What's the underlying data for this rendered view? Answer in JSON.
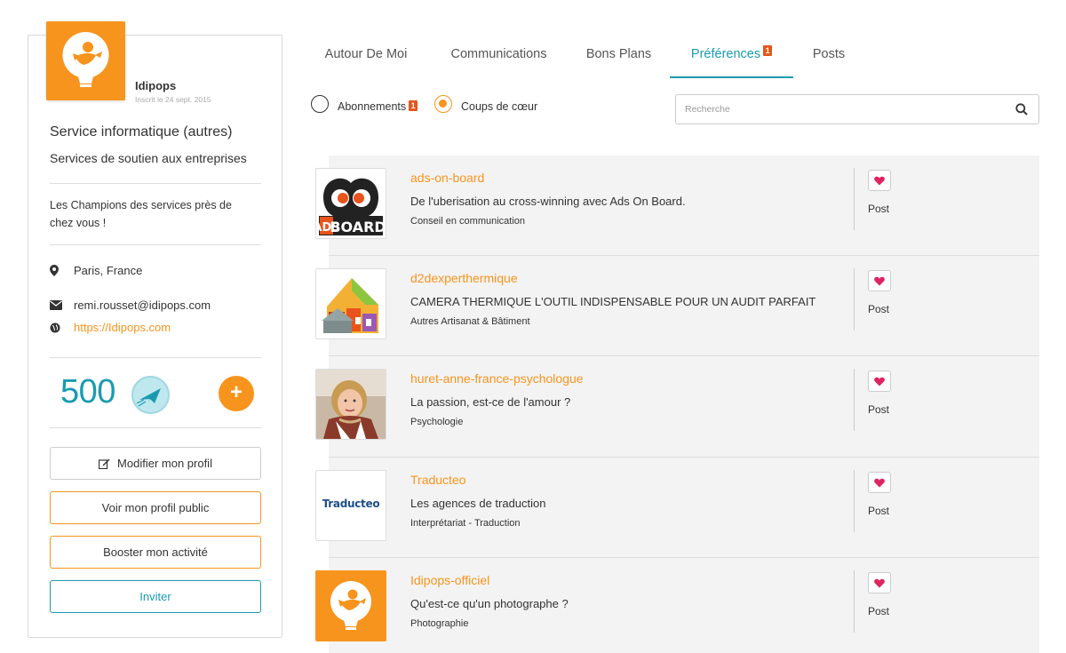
{
  "profile": {
    "username": "Idipops",
    "joined": "Inscrit le 24 sept. 2015",
    "category": "Service informatique (autres)",
    "subcategory": "Services de soutien aux entreprises",
    "tagline": "Les Champions des services près de chez vous !",
    "location": "Paris, France",
    "email": "remi.rousset@idipops.com",
    "website": "https://Idipops.com",
    "points": "500",
    "plus_label": "+",
    "buttons": {
      "edit": "Modifier mon profil",
      "public": "Voir mon profil public",
      "boost": "Booster mon activité",
      "invite": "Inviter"
    }
  },
  "tabs": [
    {
      "label": "Autour De Moi"
    },
    {
      "label": "Communications"
    },
    {
      "label": "Bons Plans"
    },
    {
      "label": "Préférences",
      "badge": "1",
      "active": true
    },
    {
      "label": "Posts"
    }
  ],
  "filters": {
    "subscriptions_label": "Abonnements",
    "subscriptions_badge": "1",
    "favorites_label": "Coups de cœur",
    "selected": "Coups de cœur"
  },
  "search": {
    "placeholder": "Recherche",
    "value": ""
  },
  "items": [
    {
      "title": "ads-on-board",
      "description": "De l'uberisation au cross-winning avec Ads On Board.",
      "category": "Conseil en communication",
      "post_label": "Post",
      "thumb": "adsboard-logo"
    },
    {
      "title": "d2dexperthermique",
      "description": "CAMERA THERMIQUE L'OUTIL INDISPENSABLE POUR UN AUDIT PARFAIT",
      "category": "Autres Artisanat & Bâtiment",
      "post_label": "Post",
      "thumb": "thermal-house"
    },
    {
      "title": "huret-anne-france-psychologue",
      "description": "La passion, est-ce de l'amour ?",
      "category": "Psychologie",
      "post_label": "Post",
      "thumb": "portrait-photo"
    },
    {
      "title": "Traducteo",
      "description": "Les agences de traduction",
      "category": "Interprétariat - Traduction",
      "post_label": "Post",
      "thumb": "traducteo-logo",
      "thumb_text": "Traducteo"
    },
    {
      "title": "Idipops-officiel",
      "description": "Qu'est-ce qu'un photographe ?",
      "category": "Photographie",
      "post_label": "Post",
      "thumb": "idipops-logo"
    }
  ],
  "colors": {
    "accent": "#f7941d",
    "teal": "#1a9bb0",
    "badge": "#e8541c",
    "heart": "#e0245e"
  }
}
